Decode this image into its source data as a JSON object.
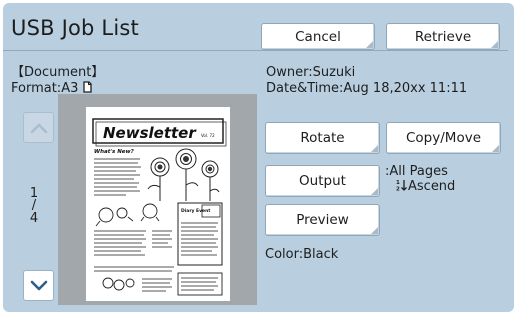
{
  "header": {
    "title": "USB Job List",
    "cancel_label": "Cancel",
    "retrieve_label": "Retrieve"
  },
  "document": {
    "heading": "【Document】",
    "format_prefix": "Format:",
    "format_value": "A3",
    "format_icon": "portrait-page-icon"
  },
  "meta": {
    "owner": "Owner:Suzuki",
    "datetime": "Date&Time:Aug 18,20xx 11:11"
  },
  "pager": {
    "current": "1",
    "separator": "/",
    "total": "4",
    "up_icon": "chevron-up-icon",
    "down_icon": "chevron-down-icon"
  },
  "preview": {
    "newsletter_title": "Newsletter",
    "volume": "Vol. 72",
    "headline": "What's New?",
    "box_title": "Diary Event"
  },
  "actions": {
    "rotate_label": "Rotate",
    "copy_move_label": "Copy/Move",
    "output_label": "Output",
    "preview_label": "Preview"
  },
  "output_settings": {
    "pages": ":All Pages",
    "order_icon": "sort-ascending-icon",
    "order": "Ascend"
  },
  "color": "Color:Black",
  "colors": {
    "panel": "#b9cfe0",
    "button": "#ffffff",
    "preview_bg": "#a2a7ab",
    "nav_disabled": "#a9bfd0"
  }
}
